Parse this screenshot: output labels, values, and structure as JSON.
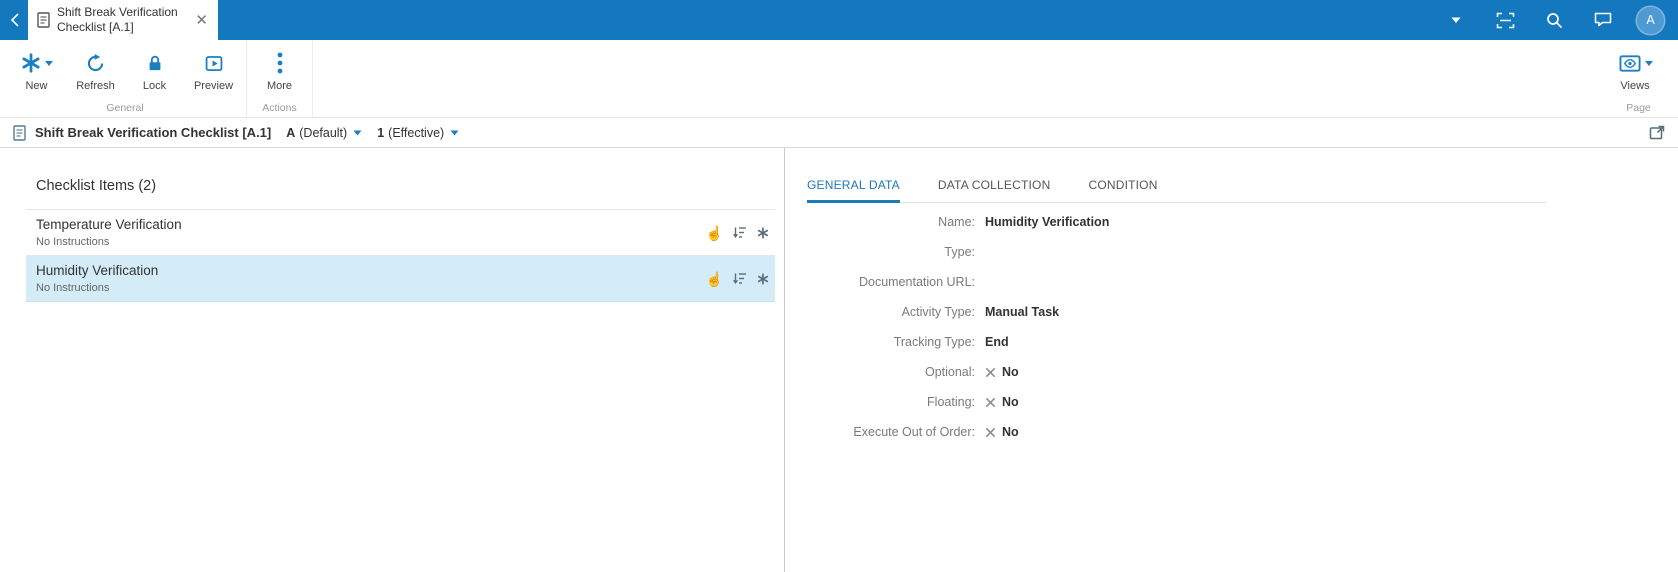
{
  "topbar": {
    "tab_title": "Shift Break Verification Checklist [A.1]",
    "avatar_initial": "A"
  },
  "ribbon": {
    "buttons": {
      "new": "New",
      "refresh": "Refresh",
      "lock": "Lock",
      "preview": "Preview",
      "more": "More",
      "views": "Views"
    },
    "groups": {
      "general": "General",
      "actions": "Actions",
      "page": "Page"
    }
  },
  "breadcrumb": {
    "title": "Shift Break Verification Checklist [A.1]",
    "revision": "A",
    "revision_label": "(Default)",
    "version": "1",
    "version_label": "(Effective)"
  },
  "checklist": {
    "heading": "Checklist Items (2)",
    "items": [
      {
        "name": "Temperature Verification",
        "instructions": "No Instructions"
      },
      {
        "name": "Humidity Verification",
        "instructions": "No Instructions"
      }
    ]
  },
  "details": {
    "tabs": {
      "general_data": "GENERAL DATA",
      "data_collection": "DATA COLLECTION",
      "condition": "CONDITION"
    },
    "fields": [
      {
        "label": "Name:",
        "value": "Humidity Verification"
      },
      {
        "label": "Type:",
        "value": ""
      },
      {
        "label": "Documentation URL:",
        "value": ""
      },
      {
        "label": "Activity Type:",
        "value": "Manual Task"
      },
      {
        "label": "Tracking Type:",
        "value": "End"
      },
      {
        "label": "Optional:",
        "value": "No"
      },
      {
        "label": "Floating:",
        "value": "No"
      },
      {
        "label": "Execute Out of Order:",
        "value": "No"
      }
    ]
  },
  "icons": {
    "hand": "☝"
  },
  "colors": {
    "topbar_blue": "#1478BE",
    "icon_blue": "#1B7FC2",
    "active_tab_blue": "#1B7AB8",
    "selected_row_bg": "#D4EBF8"
  }
}
